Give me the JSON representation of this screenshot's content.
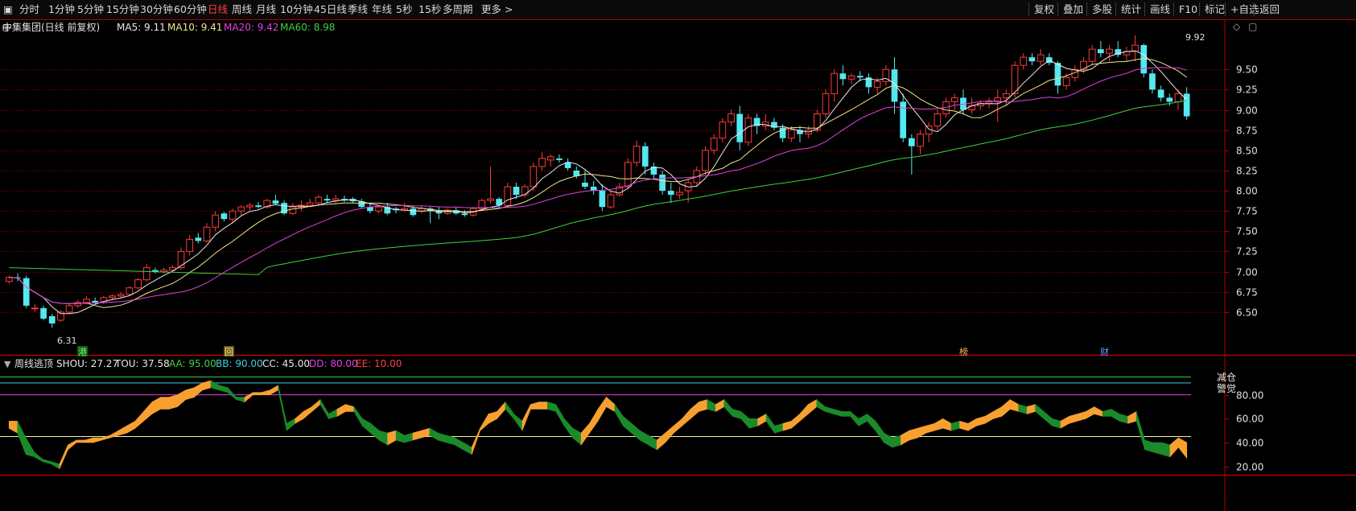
{
  "toolbar": {
    "periods": [
      "分时",
      "1分钟",
      "5分钟",
      "15分钟",
      "30分钟",
      "60分钟",
      "日线",
      "周线",
      "月线",
      "10分钟",
      "45日线",
      "季线",
      "年线",
      "5秒",
      "15秒",
      "多周期",
      "更多 >"
    ],
    "active_period": "日线",
    "right_buttons": [
      "复权",
      "叠加",
      "多股",
      "统计",
      "画线",
      "F10",
      "标记",
      "+自选",
      "返回"
    ]
  },
  "main_header": {
    "title": "中集集团(日线 前复权)",
    "ma": [
      {
        "label": "MA5: 9.11",
        "color": "#e8e8e8"
      },
      {
        "label": "MA10: 9.41",
        "color": "#f0e68c"
      },
      {
        "label": "MA20: 9.42",
        "color": "#e040e0"
      },
      {
        "label": "MA60: 8.98",
        "color": "#40d040"
      }
    ]
  },
  "sub_header": {
    "title": "周线逃顶",
    "items": [
      {
        "label": "SHOU: 27.27",
        "color": "#e8e8e8"
      },
      {
        "label": "TOU: 37.58",
        "color": "#e8e8e8"
      },
      {
        "label": "AA: 95.00",
        "color": "#40d040"
      },
      {
        "label": "BB: 90.00",
        "color": "#40d0d0"
      },
      {
        "label": "CC: 45.00",
        "color": "#e8e8e8"
      },
      {
        "label": "DD: 80.00",
        "color": "#e040e0"
      },
      {
        "label": "EE: 10.00",
        "color": "#ff4040"
      }
    ],
    "side_labels": [
      "减仓",
      "警觉"
    ]
  },
  "markers": {
    "max_label": "9.92",
    "min_label": "6.31",
    "events": [
      "港",
      "回",
      "榜",
      "财"
    ]
  },
  "colors": {
    "up": "#ff3a3a",
    "down": "#54e8f0",
    "grid": "#5a0000",
    "axis": "#b00000",
    "orange": "#f7a030",
    "green": "#1a8a2a"
  },
  "chart_data": [
    {
      "type": "candlestick",
      "title": "中集集团(日线 前复权)",
      "y_ticks": [
        "9.50",
        "9.25",
        "9.00",
        "8.75",
        "8.50",
        "8.25",
        "8.00",
        "7.75",
        "7.50",
        "7.25",
        "7.00",
        "6.75",
        "6.50"
      ],
      "ylim": [
        6.31,
        9.92
      ],
      "max": 9.92,
      "min": 6.31,
      "last": {
        "MA5": 9.11,
        "MA10": 9.41,
        "MA20": 9.42,
        "MA60": 8.98
      },
      "ohlc": [
        [
          6.88,
          6.95,
          6.85,
          6.93
        ],
        [
          6.93,
          6.98,
          6.88,
          6.92
        ],
        [
          6.92,
          6.95,
          6.55,
          6.58
        ],
        [
          6.55,
          6.6,
          6.5,
          6.55
        ],
        [
          6.55,
          6.58,
          6.4,
          6.42
        ],
        [
          6.45,
          6.48,
          6.31,
          6.36
        ],
        [
          6.4,
          6.52,
          6.38,
          6.5
        ],
        [
          6.5,
          6.6,
          6.48,
          6.58
        ],
        [
          6.58,
          6.65,
          6.55,
          6.62
        ],
        [
          6.62,
          6.7,
          6.6,
          6.66
        ],
        [
          6.64,
          6.68,
          6.6,
          6.62
        ],
        [
          6.62,
          6.7,
          6.6,
          6.68
        ],
        [
          6.68,
          6.72,
          6.65,
          6.7
        ],
        [
          6.7,
          6.75,
          6.68,
          6.72
        ],
        [
          6.72,
          6.82,
          6.7,
          6.8
        ],
        [
          6.8,
          6.92,
          6.78,
          6.9
        ],
        [
          6.9,
          7.1,
          6.88,
          7.05
        ],
        [
          7.02,
          7.05,
          6.98,
          7.0
        ],
        [
          7.0,
          7.05,
          6.98,
          7.02
        ],
        [
          7.02,
          7.08,
          7.0,
          7.05
        ],
        [
          7.05,
          7.3,
          7.02,
          7.25
        ],
        [
          7.25,
          7.45,
          7.2,
          7.4
        ],
        [
          7.42,
          7.48,
          7.35,
          7.38
        ],
        [
          7.38,
          7.6,
          7.36,
          7.55
        ],
        [
          7.55,
          7.75,
          7.5,
          7.7
        ],
        [
          7.72,
          7.74,
          7.62,
          7.65
        ],
        [
          7.65,
          7.78,
          7.6,
          7.75
        ],
        [
          7.75,
          7.82,
          7.7,
          7.8
        ],
        [
          7.8,
          7.85,
          7.75,
          7.82
        ],
        [
          7.82,
          7.86,
          7.78,
          7.8
        ],
        [
          7.8,
          7.9,
          7.78,
          7.88
        ],
        [
          7.88,
          7.95,
          7.82,
          7.84
        ],
        [
          7.85,
          7.88,
          7.7,
          7.72
        ],
        [
          7.72,
          7.85,
          7.7,
          7.8
        ],
        [
          7.8,
          7.88,
          7.75,
          7.82
        ],
        [
          7.82,
          7.9,
          7.8,
          7.85
        ],
        [
          7.85,
          7.95,
          7.82,
          7.92
        ],
        [
          7.9,
          7.95,
          7.85,
          7.88
        ],
        [
          7.88,
          7.95,
          7.85,
          7.9
        ],
        [
          7.9,
          7.94,
          7.86,
          7.88
        ],
        [
          7.9,
          7.92,
          7.85,
          7.87
        ],
        [
          7.87,
          7.9,
          7.78,
          7.8
        ],
        [
          7.8,
          7.85,
          7.72,
          7.75
        ],
        [
          7.75,
          7.82,
          7.72,
          7.8
        ],
        [
          7.8,
          7.85,
          7.7,
          7.72
        ],
        [
          7.78,
          7.8,
          7.72,
          7.76
        ],
        [
          7.76,
          7.85,
          7.74,
          7.78
        ],
        [
          7.78,
          7.82,
          7.68,
          7.7
        ],
        [
          7.75,
          7.82,
          7.72,
          7.78
        ],
        [
          7.78,
          7.8,
          7.6,
          7.75
        ],
        [
          7.75,
          7.8,
          7.65,
          7.72
        ],
        [
          7.72,
          7.78,
          7.7,
          7.76
        ],
        [
          7.76,
          7.8,
          7.7,
          7.72
        ],
        [
          7.72,
          7.76,
          7.68,
          7.7
        ],
        [
          7.7,
          7.8,
          7.68,
          7.78
        ],
        [
          7.78,
          7.9,
          7.76,
          7.88
        ],
        [
          7.88,
          8.3,
          7.84,
          7.9
        ],
        [
          7.9,
          7.92,
          7.78,
          7.82
        ],
        [
          7.82,
          8.1,
          7.8,
          8.05
        ],
        [
          8.05,
          8.1,
          7.9,
          7.95
        ],
        [
          7.95,
          8.08,
          7.92,
          8.05
        ],
        [
          8.05,
          8.35,
          8.0,
          8.3
        ],
        [
          8.3,
          8.48,
          8.25,
          8.4
        ],
        [
          8.38,
          8.45,
          8.3,
          8.42
        ],
        [
          8.4,
          8.45,
          8.35,
          8.38
        ],
        [
          8.35,
          8.4,
          8.25,
          8.28
        ],
        [
          8.25,
          8.3,
          8.15,
          8.18
        ],
        [
          8.1,
          8.25,
          8.02,
          8.05
        ],
        [
          8.05,
          8.12,
          7.95,
          8.0
        ],
        [
          8.0,
          8.08,
          7.75,
          7.8
        ],
        [
          7.8,
          8.0,
          7.78,
          7.95
        ],
        [
          7.95,
          8.1,
          7.93,
          8.05
        ],
        [
          8.05,
          8.4,
          8.02,
          8.35
        ],
        [
          8.35,
          8.62,
          8.3,
          8.55
        ],
        [
          8.55,
          8.6,
          8.2,
          8.3
        ],
        [
          8.3,
          8.35,
          8.15,
          8.2
        ],
        [
          8.2,
          8.25,
          7.95,
          8.0
        ],
        [
          8.0,
          8.1,
          7.85,
          7.95
        ],
        [
          7.95,
          8.05,
          7.9,
          7.98
        ],
        [
          8.0,
          8.15,
          7.85,
          8.1
        ],
        [
          8.1,
          8.3,
          8.05,
          8.25
        ],
        [
          8.25,
          8.55,
          8.2,
          8.5
        ],
        [
          8.5,
          8.7,
          8.45,
          8.65
        ],
        [
          8.65,
          8.9,
          8.6,
          8.85
        ],
        [
          8.85,
          9.0,
          8.8,
          8.95
        ],
        [
          8.95,
          9.05,
          8.5,
          8.6
        ],
        [
          8.6,
          8.95,
          8.55,
          8.9
        ],
        [
          8.9,
          8.95,
          8.7,
          8.8
        ],
        [
          8.8,
          8.95,
          8.75,
          8.85
        ],
        [
          8.85,
          8.9,
          8.75,
          8.78
        ],
        [
          8.78,
          8.82,
          8.6,
          8.65
        ],
        [
          8.65,
          8.8,
          8.6,
          8.75
        ],
        [
          8.75,
          8.8,
          8.6,
          8.7
        ],
        [
          8.7,
          8.8,
          8.65,
          8.75
        ],
        [
          8.75,
          9.0,
          8.72,
          8.95
        ],
        [
          8.95,
          9.25,
          8.9,
          9.2
        ],
        [
          9.2,
          9.5,
          9.1,
          9.45
        ],
        [
          9.45,
          9.55,
          9.3,
          9.38
        ],
        [
          9.38,
          9.45,
          9.32,
          9.42
        ],
        [
          9.42,
          9.48,
          9.35,
          9.4
        ],
        [
          9.4,
          9.45,
          9.2,
          9.28
        ],
        [
          9.28,
          9.4,
          9.2,
          9.35
        ],
        [
          9.35,
          9.55,
          9.3,
          9.5
        ],
        [
          9.5,
          9.65,
          8.95,
          9.1
        ],
        [
          9.1,
          9.2,
          8.6,
          8.65
        ],
        [
          8.65,
          8.7,
          8.2,
          8.55
        ],
        [
          8.55,
          8.75,
          8.45,
          8.7
        ],
        [
          8.7,
          8.85,
          8.6,
          8.8
        ],
        [
          8.8,
          9.0,
          8.75,
          8.95
        ],
        [
          8.95,
          9.15,
          8.9,
          9.1
        ],
        [
          9.1,
          9.2,
          9.0,
          9.15
        ],
        [
          9.15,
          9.25,
          8.95,
          9.0
        ],
        [
          9.0,
          9.15,
          8.95,
          9.05
        ],
        [
          9.05,
          9.12,
          9.0,
          9.08
        ],
        [
          9.08,
          9.15,
          9.02,
          9.1
        ],
        [
          9.1,
          9.25,
          8.85,
          9.15
        ],
        [
          9.15,
          9.25,
          9.05,
          9.2
        ],
        [
          9.2,
          9.6,
          9.15,
          9.55
        ],
        [
          9.55,
          9.7,
          9.5,
          9.65
        ],
        [
          9.65,
          9.7,
          9.55,
          9.6
        ],
        [
          9.6,
          9.75,
          9.55,
          9.68
        ],
        [
          9.65,
          9.7,
          9.55,
          9.58
        ],
        [
          9.58,
          9.6,
          9.2,
          9.3
        ],
        [
          9.3,
          9.45,
          9.25,
          9.4
        ],
        [
          9.4,
          9.55,
          9.35,
          9.5
        ],
        [
          9.5,
          9.65,
          9.45,
          9.6
        ],
        [
          9.6,
          9.8,
          9.55,
          9.75
        ],
        [
          9.75,
          9.85,
          9.65,
          9.7
        ],
        [
          9.7,
          9.8,
          9.6,
          9.75
        ],
        [
          9.75,
          9.85,
          9.65,
          9.68
        ],
        [
          9.68,
          9.78,
          9.6,
          9.72
        ],
        [
          9.72,
          9.92,
          9.6,
          9.8
        ],
        [
          9.8,
          9.82,
          9.4,
          9.45
        ],
        [
          9.45,
          9.5,
          9.2,
          9.25
        ],
        [
          9.25,
          9.3,
          9.1,
          9.15
        ],
        [
          9.15,
          9.2,
          9.05,
          9.1
        ],
        [
          9.1,
          9.25,
          9.0,
          9.2
        ],
        [
          9.2,
          9.28,
          8.88,
          8.92
        ]
      ]
    },
    {
      "type": "area",
      "title": "周线逃顶",
      "series_names": [
        "SHOU",
        "TOU"
      ],
      "y_ticks": [
        "80.00",
        "60.00",
        "40.00",
        "20.00"
      ],
      "ylim": [
        15,
        100
      ],
      "levels": [
        {
          "name": "AA",
          "value": 95
        },
        {
          "name": "BB",
          "value": 90
        },
        {
          "name": "CC",
          "value": 45
        },
        {
          "name": "DD",
          "value": 80
        },
        {
          "name": "EE",
          "value": 10
        }
      ],
      "last": {
        "SHOU": 27.27,
        "TOU": 37.58
      },
      "tou": [
        58,
        58,
        44,
        32,
        26,
        24,
        22,
        38,
        42,
        42,
        44,
        44,
        46,
        50,
        54,
        58,
        66,
        74,
        78,
        78,
        80,
        84,
        86,
        90,
        92,
        88,
        86,
        78,
        78,
        82,
        82,
        84,
        88,
        56,
        60,
        66,
        70,
        76,
        64,
        68,
        72,
        70,
        60,
        56,
        50,
        48,
        50,
        46,
        48,
        50,
        52,
        48,
        46,
        44,
        40,
        36,
        52,
        64,
        66,
        74,
        64,
        58,
        72,
        74,
        74,
        72,
        60,
        52,
        48,
        56,
        68,
        78,
        72,
        62,
        56,
        50,
        46,
        42,
        48,
        54,
        60,
        68,
        74,
        76,
        72,
        76,
        68,
        66,
        60,
        60,
        64,
        54,
        56,
        58,
        64,
        72,
        76,
        70,
        68,
        66,
        66,
        60,
        64,
        58,
        48,
        44,
        46,
        50,
        52,
        54,
        56,
        60,
        56,
        58,
        56,
        60,
        62,
        66,
        70,
        76,
        72,
        70,
        72,
        66,
        60,
        58,
        62,
        64,
        66,
        70,
        66,
        68,
        64,
        62,
        66,
        42,
        40,
        40,
        38,
        44,
        40
      ],
      "shou": [
        52,
        48,
        30,
        28,
        24,
        22,
        18,
        34,
        40,
        40,
        40,
        42,
        44,
        46,
        48,
        52,
        58,
        64,
        68,
        68,
        70,
        76,
        78,
        84,
        86,
        84,
        82,
        76,
        74,
        80,
        80,
        80,
        84,
        50,
        56,
        60,
        66,
        72,
        60,
        62,
        66,
        66,
        54,
        48,
        42,
        38,
        42,
        40,
        42,
        44,
        46,
        42,
        40,
        38,
        34,
        30,
        50,
        56,
        60,
        68,
        60,
        50,
        68,
        68,
        68,
        66,
        54,
        44,
        38,
        48,
        58,
        70,
        66,
        54,
        48,
        42,
        38,
        34,
        40,
        48,
        54,
        60,
        66,
        68,
        66,
        70,
        62,
        60,
        52,
        54,
        58,
        48,
        50,
        52,
        58,
        64,
        70,
        66,
        64,
        62,
        62,
        54,
        58,
        50,
        40,
        36,
        38,
        42,
        44,
        48,
        50,
        52,
        50,
        52,
        50,
        54,
        56,
        60,
        62,
        68,
        66,
        64,
        66,
        60,
        54,
        52,
        56,
        58,
        60,
        64,
        62,
        62,
        58,
        56,
        58,
        34,
        32,
        30,
        28,
        36,
        27
      ]
    }
  ]
}
